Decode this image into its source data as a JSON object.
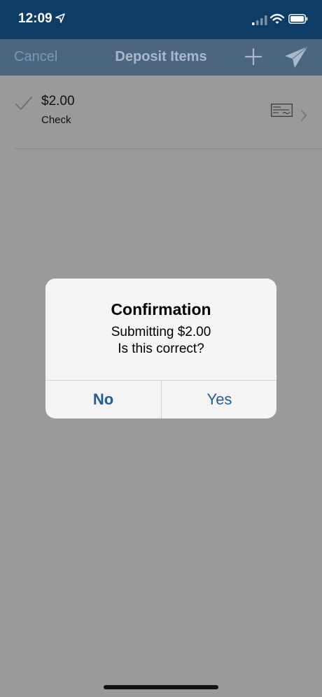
{
  "status_bar": {
    "time": "12:09",
    "icons": [
      "location-arrow-icon",
      "cellular-signal-icon",
      "wifi-icon",
      "battery-icon"
    ]
  },
  "nav": {
    "cancel_label": "Cancel",
    "title": "Deposit Items",
    "add_icon": "plus-icon",
    "submit_icon": "paper-plane-icon"
  },
  "items": [
    {
      "amount": "$2.00",
      "type": "Check",
      "status_icon": "checkmark-icon",
      "item_icon": "check-document-icon"
    }
  ],
  "alert": {
    "title": "Confirmation",
    "message_line1": "Submitting $2.00",
    "message_line2": "Is this correct?",
    "no_label": "No",
    "yes_label": "Yes"
  },
  "colors": {
    "nav_background": "#0d3c66",
    "dim_overlay": "#9a9a9a",
    "alert_background": "#f4f4f4",
    "button_text": "#1f5f95"
  }
}
